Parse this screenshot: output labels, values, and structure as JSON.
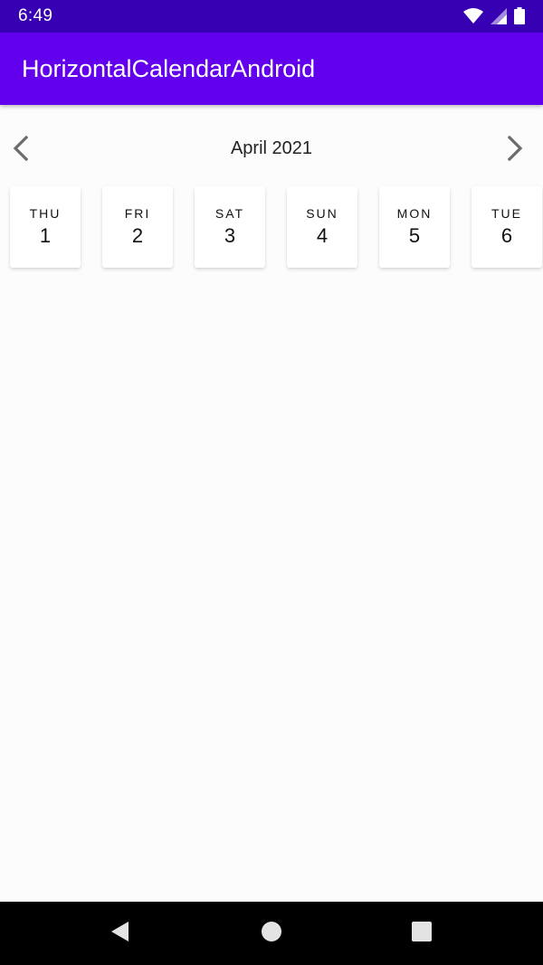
{
  "status_bar": {
    "time": "6:49",
    "icons": [
      "wifi-icon",
      "signal-icon",
      "battery-icon"
    ]
  },
  "app_bar": {
    "title": "HorizontalCalendarAndroid",
    "color": "#6200ee",
    "status_color": "#3700b3"
  },
  "calendar": {
    "month_label": "April 2021",
    "prev_icon": "chevron-left-icon",
    "next_icon": "chevron-right-icon",
    "days": [
      {
        "name": "THU",
        "number": "1"
      },
      {
        "name": "FRI",
        "number": "2"
      },
      {
        "name": "SAT",
        "number": "3"
      },
      {
        "name": "SUN",
        "number": "4"
      },
      {
        "name": "MON",
        "number": "5"
      },
      {
        "name": "TUE",
        "number": "6"
      }
    ]
  },
  "system_nav": {
    "buttons": [
      "back-icon",
      "home-icon",
      "recents-icon"
    ]
  }
}
